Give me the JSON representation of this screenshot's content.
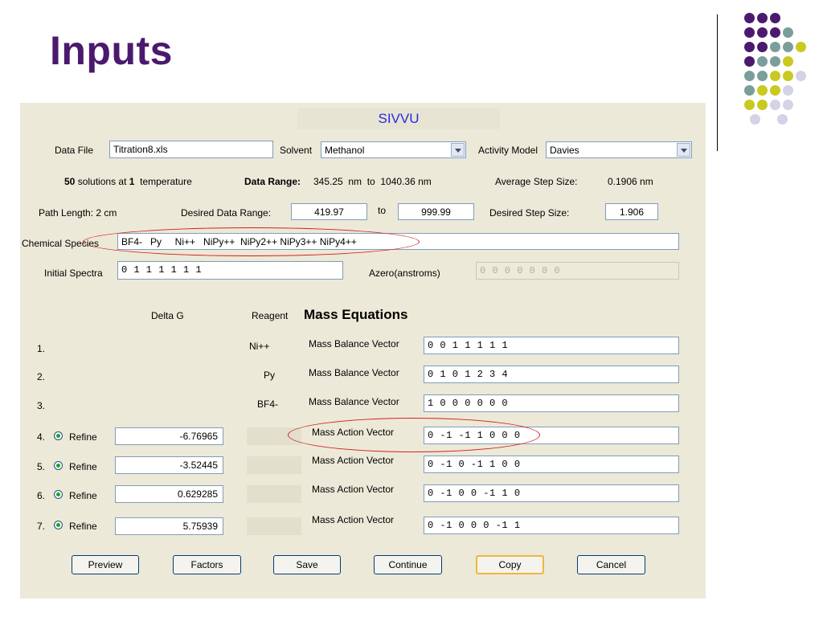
{
  "slide": {
    "title": "Inputs"
  },
  "app": {
    "title": "SIVVU"
  },
  "colors": {
    "title": "#4b1a6e",
    "accent": "#2929e0",
    "purple": "#4b1a6e",
    "teal": "#7a9e9a",
    "olive": "#c9c920",
    "lavender": "#d3d3e6",
    "highlight_ring": "#d42020"
  },
  "row1": {
    "data_file_label": "Data File",
    "data_file_value": "Titration8.xls",
    "solvent_label": "Solvent",
    "solvent_value": "Methanol",
    "activity_label": "Activity Model",
    "activity_value": "Davies"
  },
  "row2": {
    "solutions_count": "50",
    "solutions_text": "solutions at",
    "temp_count": "1",
    "temp_text": "temperature",
    "range_label": "Data Range:",
    "range_text": "345.25  nm  to  1040.36 nm",
    "avg_step_label": "Average Step Size:",
    "avg_step_value": "0.1906 nm"
  },
  "row3": {
    "path_length": "Path Length: 2 cm",
    "desired_range_label": "Desired Data Range:",
    "range_from": "419.97",
    "to_label": "to",
    "range_to": "999.99",
    "desired_step_label": "Desired Step Size:",
    "desired_step_value": "1.906"
  },
  "chemical": {
    "label": "Chemical Species",
    "value": "BF4-   Py     Ni++   NiPy++  NiPy2++ NiPy3++ NiPy4++"
  },
  "initial": {
    "label": "Initial Spectra",
    "value": "0 1 1 1 1 1 1",
    "azero_label": "Azero(anstroms)",
    "azero_value": "0 0 0 0 0 0 0"
  },
  "headers": {
    "delta_g": "Delta G",
    "reagent": "Reagent",
    "mass_equations": "Mass Equations"
  },
  "equations": [
    {
      "num": "1.",
      "reagent": "Ni++",
      "type": "Mass Balance Vector",
      "vector": "0 0 1 1 1 1 1"
    },
    {
      "num": "2.",
      "reagent": "Py",
      "type": "Mass Balance Vector",
      "vector": "0 1 0 1 2 3 4"
    },
    {
      "num": "3.",
      "reagent": "BF4-",
      "type": "Mass Balance Vector",
      "vector": "1 0 0 0 0 0 0"
    },
    {
      "num": "4.",
      "refine": "Refine",
      "delta_g": "-6.76965",
      "type": "Mass Action Vector",
      "vector": "0 -1 -1 1 0 0 0"
    },
    {
      "num": "5.",
      "refine": "Refine",
      "delta_g": "-3.52445",
      "type": "Mass Action Vector",
      "vector": "0 -1 0 -1 1 0 0"
    },
    {
      "num": "6.",
      "refine": "Refine",
      "delta_g": "0.629285",
      "type": "Mass Action Vector",
      "vector": "0 -1 0 0 -1 1 0"
    },
    {
      "num": "7.",
      "refine": "Refine",
      "delta_g": "5.75939",
      "type": "Mass Action Vector",
      "vector": "0 -1 0 0 0 -1 1"
    }
  ],
  "buttons": {
    "preview": "Preview",
    "factors": "Factors",
    "save": "Save",
    "continue": "Continue",
    "copy": "Copy",
    "cancel": "Cancel"
  }
}
